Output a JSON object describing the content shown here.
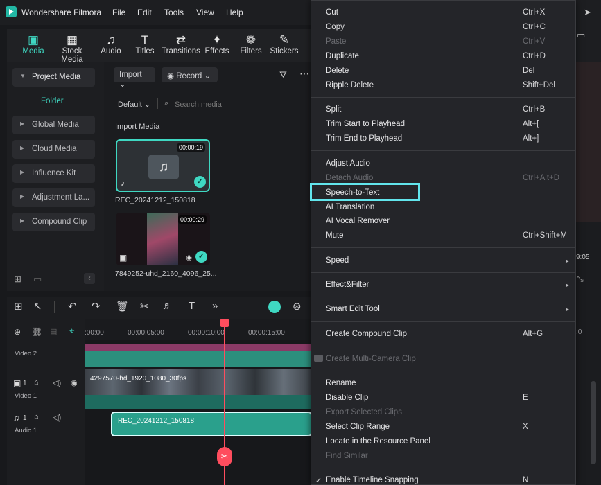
{
  "app": {
    "title": "Wondershare Filmora",
    "menus": [
      "File",
      "Edit",
      "Tools",
      "View",
      "Help"
    ]
  },
  "toolbar": {
    "tabs": [
      {
        "label": "Media",
        "icon": "media-icon"
      },
      {
        "label": "Stock Media",
        "icon": "stock-media-icon"
      },
      {
        "label": "Audio",
        "icon": "music-note-icon"
      },
      {
        "label": "Titles",
        "icon": "titles-icon"
      },
      {
        "label": "Transitions",
        "icon": "transitions-icon"
      },
      {
        "label": "Effects",
        "icon": "effects-icon"
      },
      {
        "label": "Filters",
        "icon": "filters-icon"
      },
      {
        "label": "Stickers",
        "icon": "stickers-icon"
      }
    ]
  },
  "sidebar": {
    "items": [
      {
        "label": "Project Media"
      },
      {
        "label": "Folder"
      },
      {
        "label": "Global Media"
      },
      {
        "label": "Cloud Media"
      },
      {
        "label": "Influence Kit"
      },
      {
        "label": "Adjustment La..."
      },
      {
        "label": "Compound Clip"
      }
    ]
  },
  "media": {
    "import_label": "Import",
    "record_label": "Record",
    "sort_label": "Default",
    "search_placeholder": "Search media",
    "section_title": "Import Media",
    "items": [
      {
        "name": "REC_20241212_150818",
        "duration": "00:00:19"
      },
      {
        "name": "7849252-uhd_2160_4096_25...",
        "duration": "00:00:29"
      }
    ]
  },
  "timeline": {
    "ticks": [
      ":00:00",
      "00:00:05:00",
      "00:00:10:00",
      "00:00:15:00"
    ],
    "tracks": [
      {
        "label": "Video 2"
      },
      {
        "label": "Video 1",
        "index": "1"
      },
      {
        "label": "Audio 1",
        "index": "1"
      }
    ],
    "clips": {
      "video1": "4297570-hd_1920_1080_30fps",
      "audio1": "REC_20241212_150818"
    }
  },
  "preview": {
    "time_fragment": "9:05",
    "ruler_fragment": ":0"
  },
  "context_menu": {
    "items": [
      {
        "label": "Cut",
        "shortcut": "Ctrl+X",
        "disabled": false
      },
      {
        "label": "Copy",
        "shortcut": "Ctrl+C",
        "disabled": false
      },
      {
        "label": "Paste",
        "shortcut": "Ctrl+V",
        "disabled": true
      },
      {
        "label": "Duplicate",
        "shortcut": "Ctrl+D",
        "disabled": false
      },
      {
        "label": "Delete",
        "shortcut": "Del",
        "disabled": false
      },
      {
        "label": "Ripple Delete",
        "shortcut": "Shift+Del",
        "disabled": false
      },
      {
        "label": "Split",
        "shortcut": "Ctrl+B",
        "disabled": false
      },
      {
        "label": "Trim Start to Playhead",
        "shortcut": "Alt+[",
        "disabled": false
      },
      {
        "label": "Trim End to Playhead",
        "shortcut": "Alt+]",
        "disabled": false
      },
      {
        "label": "Adjust Audio",
        "shortcut": "",
        "disabled": false
      },
      {
        "label": "Detach Audio",
        "shortcut": "Ctrl+Alt+D",
        "disabled": true
      },
      {
        "label": "Speech-to-Text",
        "shortcut": "",
        "disabled": false,
        "highlighted": true
      },
      {
        "label": "AI Translation",
        "shortcut": "",
        "disabled": false
      },
      {
        "label": "AI Vocal Remover",
        "shortcut": "",
        "disabled": false
      },
      {
        "label": "Mute",
        "shortcut": "Ctrl+Shift+M",
        "disabled": false
      },
      {
        "label": "Speed",
        "shortcut": "",
        "disabled": false,
        "submenu": true
      },
      {
        "label": "Effect&Filter",
        "shortcut": "",
        "disabled": false,
        "submenu": true
      },
      {
        "label": "Smart Edit Tool",
        "shortcut": "",
        "disabled": false,
        "submenu": true
      },
      {
        "label": "Create Compound Clip",
        "shortcut": "Alt+G",
        "disabled": false
      },
      {
        "label": "Create Multi-Camera Clip",
        "shortcut": "",
        "disabled": true
      },
      {
        "label": "Rename",
        "shortcut": "",
        "disabled": false
      },
      {
        "label": "Disable Clip",
        "shortcut": "E",
        "disabled": false
      },
      {
        "label": "Export Selected Clips",
        "shortcut": "",
        "disabled": true
      },
      {
        "label": "Select Clip Range",
        "shortcut": "X",
        "disabled": false
      },
      {
        "label": "Locate in the Resource Panel",
        "shortcut": "",
        "disabled": false
      },
      {
        "label": "Find Similar",
        "shortcut": "",
        "disabled": true
      },
      {
        "label": "Enable Timeline Snapping",
        "shortcut": "N",
        "disabled": false,
        "checked": true
      }
    ]
  },
  "colors": {
    "accent": "#3fd8c2",
    "highlight": "#62e5ec",
    "playhead": "#ff4d5e"
  }
}
